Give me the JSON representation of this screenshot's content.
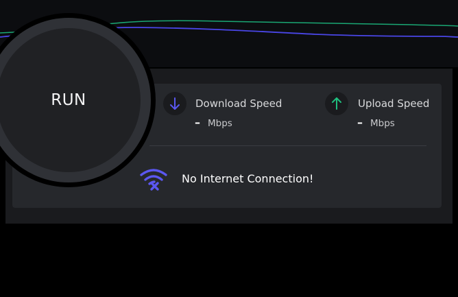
{
  "graph": {
    "download_color": "#4a46e8",
    "upload_color": "#1aa874"
  },
  "run_button": {
    "label": "RUN"
  },
  "download": {
    "label": "Download Speed",
    "value": "–",
    "unit": "Mbps",
    "icon": "arrow-down-icon",
    "color": "#5b57f0"
  },
  "upload": {
    "label": "Upload Speed",
    "value": "–",
    "unit": "Mbps",
    "icon": "arrow-up-icon",
    "color": "#1fbf7f"
  },
  "status": {
    "icon": "wifi-off-icon",
    "icon_color": "#5b57f0",
    "message": "No Internet Connection!"
  }
}
